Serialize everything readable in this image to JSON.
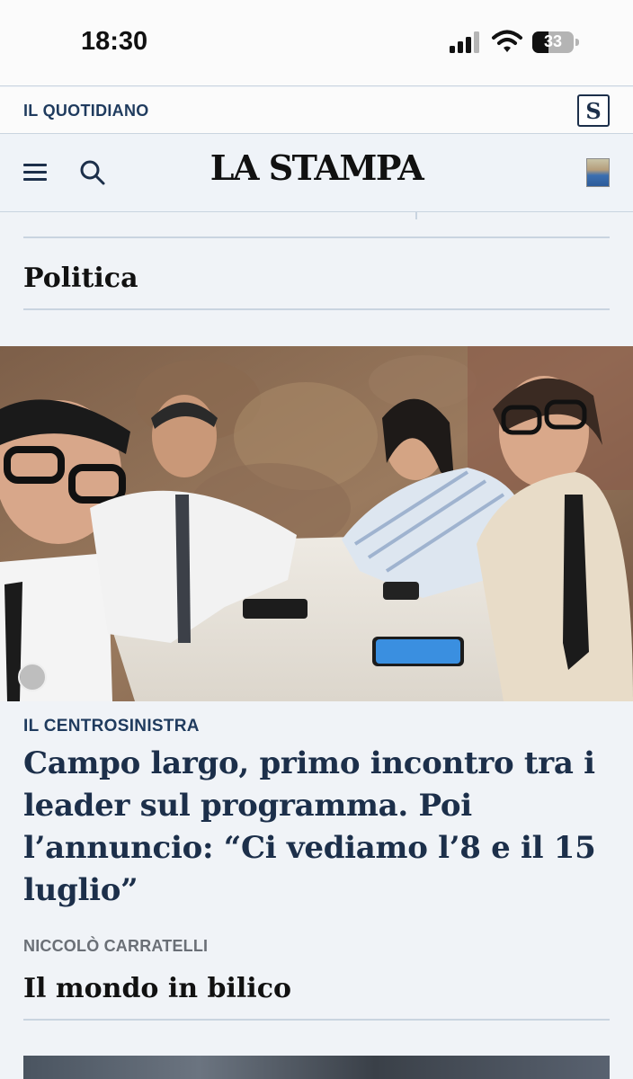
{
  "status_bar": {
    "time": "18:30",
    "battery": "33",
    "icons": [
      "signal-icon",
      "wifi-icon",
      "battery-icon"
    ]
  },
  "section_bar": {
    "label": "IL QUOTIDIANO",
    "badge": "S"
  },
  "header": {
    "logo": "LA STAMPA",
    "icons": [
      "menu-icon",
      "search-icon",
      "user-avatar"
    ]
  },
  "section": {
    "title": "Politica"
  },
  "article": {
    "kicker": "IL CENTROSINISTRA",
    "headline": "Campo largo, primo incontro tra i leader sul programma. Poi l’annuncio: “Ci vediamo l’8 e il 15 luglio”",
    "author": "NICCOLÒ CARRATELLI"
  },
  "next_section": {
    "title": "Il mondo in bilico"
  },
  "colors": {
    "navy": "#1c2f4a",
    "label_blue": "#1f3b5e",
    "background": "#f0f3f7",
    "divider": "#c9d4e0"
  }
}
